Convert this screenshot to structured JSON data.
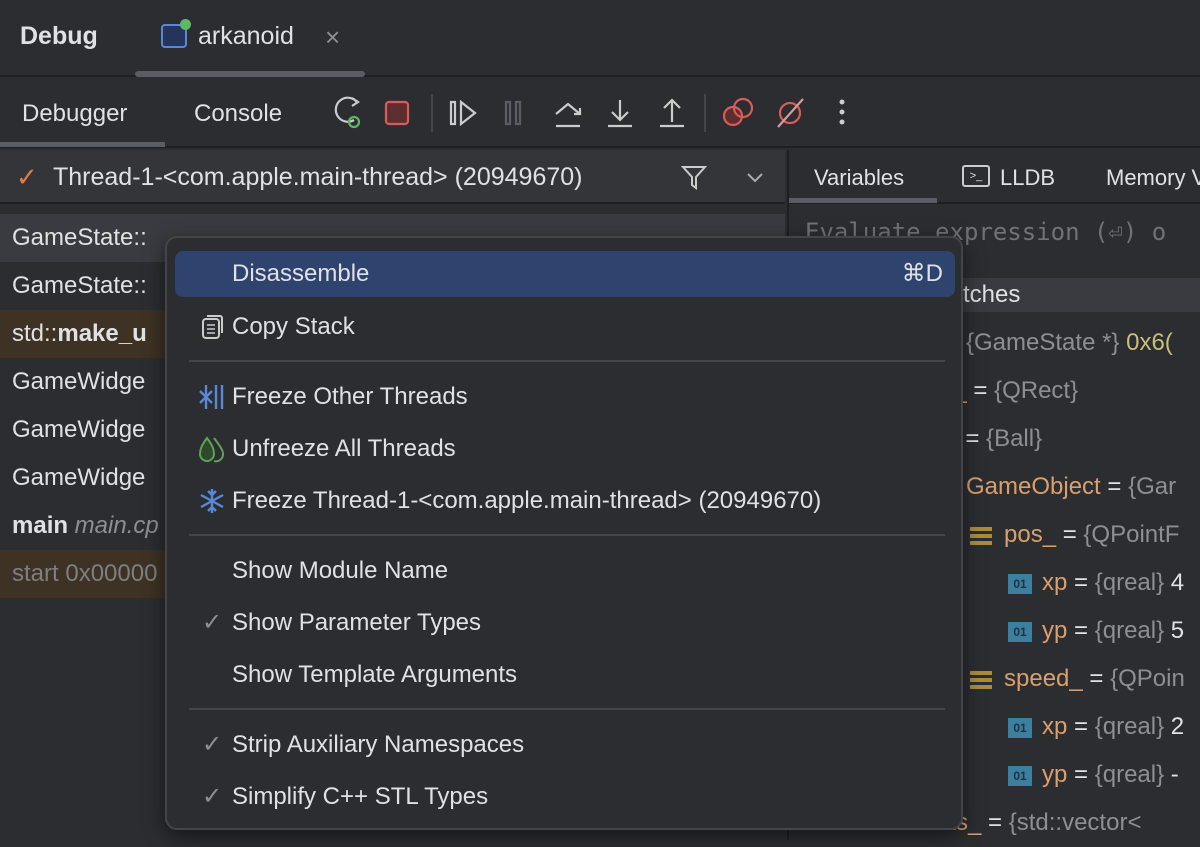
{
  "header": {
    "title": "Debug",
    "tab": {
      "label": "arkanoid",
      "close": "×"
    }
  },
  "toolbar": {
    "tabs": [
      "Debugger",
      "Console"
    ],
    "icons": [
      "rerun-debug-icon",
      "stop-icon",
      "resume-icon",
      "pause-icon",
      "step-over-icon",
      "step-into-icon",
      "step-out-icon",
      "view-breakpoints-icon",
      "mute-breakpoints-icon",
      "more-icon"
    ],
    "more": "⋮"
  },
  "thread": {
    "label": "Thread-1-<com.apple.main-thread> (20949670)"
  },
  "frames": [
    {
      "text": "GameState::",
      "bold": "",
      "extra": "",
      "style": "selected"
    },
    {
      "text": "GameState::",
      "bold": "",
      "extra": "",
      "style": "normal"
    },
    {
      "text": "std::",
      "bold": "make_u",
      "extra": "",
      "style": "library"
    },
    {
      "text": "GameWidge",
      "bold": "",
      "extra": "",
      "style": "normal"
    },
    {
      "text": "GameWidge",
      "bold": "",
      "extra": "",
      "style": "normal"
    },
    {
      "text": "GameWidge",
      "bold": "",
      "extra": "",
      "style": "normal"
    },
    {
      "text": "",
      "bold": "main",
      "extra": " main.cp",
      "style": "normal"
    },
    {
      "text": "start 0x00000",
      "bold": "",
      "extra": "",
      "style": "library-dim"
    }
  ],
  "right_tabs": [
    {
      "label": "Variables",
      "active": true
    },
    {
      "label": "LLDB"
    },
    {
      "label": "Memory V"
    }
  ],
  "evaluate": {
    "placeholder": "Evaluate expression (⏎) o"
  },
  "watches": {
    "header": "tches",
    "rows": [
      {
        "name": "",
        "eq": "",
        "type": "{GameState *}",
        "value": " 0x6("
      },
      {
        "name": "d_",
        "eq": " = ",
        "type": "{QRect}",
        "value": ""
      },
      {
        "name": "l_",
        "eq": " = ",
        "type": "{Ball}",
        "value": ""
      },
      {
        "name": "GameObject",
        "eq": " = ",
        "type": "{Gar",
        "value": ""
      },
      {
        "name": "pos_",
        "eq": " = ",
        "type": "{QPointF",
        "value": ""
      },
      {
        "name": "xp",
        "eq": " = ",
        "type": "{qreal}",
        "value": " 4"
      },
      {
        "name": "yp",
        "eq": " = ",
        "type": "{qreal}",
        "value": " 5"
      },
      {
        "name": "speed_",
        "eq": " = ",
        "type": "{QPoin",
        "value": ""
      },
      {
        "name": "xp",
        "eq": " = ",
        "type": "{qreal}",
        "value": " 2"
      },
      {
        "name": "yp",
        "eq": " = ",
        "type": "{qreal}",
        "value": " -"
      },
      {
        "name": "cks_",
        "eq": " = ",
        "type": "{std::vector<",
        "value": ""
      }
    ]
  },
  "menu": {
    "items": [
      {
        "label": "Disassemble",
        "shortcut": "⌘D",
        "highlighted": true
      },
      {
        "label": "Copy Stack",
        "icon": "copy-icon"
      },
      {
        "label": "Freeze Other Threads",
        "icon": "freeze-others-icon"
      },
      {
        "label": "Unfreeze All Threads",
        "icon": "unfreeze-icon"
      },
      {
        "label": "Freeze Thread-1-<com.apple.main-thread> (20949670)",
        "icon": "snowflake-icon"
      },
      {
        "label": "Show Module Name",
        "checked": false
      },
      {
        "label": "Show Parameter Types",
        "checked": true
      },
      {
        "label": "Show Template Arguments",
        "checked": false
      },
      {
        "label": "Strip Auxiliary Namespaces",
        "checked": true
      },
      {
        "label": "Simplify C++ STL Types",
        "checked": true
      }
    ],
    "check": "✓"
  },
  "colors": {
    "accent": "#2e436e",
    "bg": "#2b2d30",
    "library_row": "#3d3223",
    "selected_row": "#393b40"
  }
}
